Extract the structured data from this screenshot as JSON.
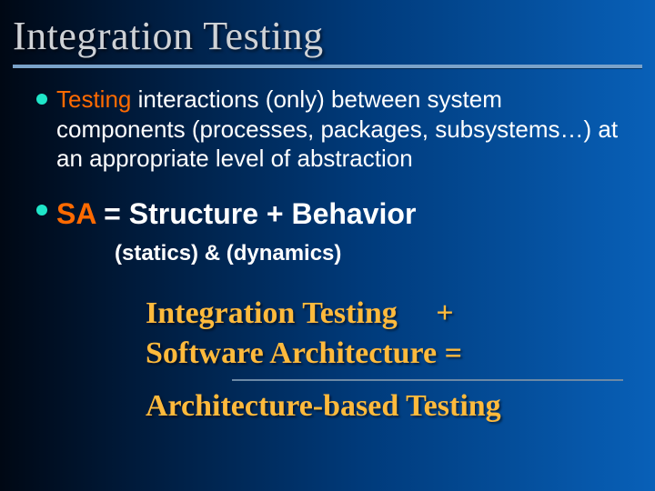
{
  "title": "Integration Testing",
  "bullet1": {
    "lead": "Testing",
    "rest": " interactions (only) between system components (processes, packages, subsystems…) at an appropriate level of abstraction"
  },
  "bullet2": {
    "sa": "SA",
    "rest": " = Structure + Behavior"
  },
  "subline": "(statics)    &  (dynamics)",
  "equation": {
    "line1": "Integration Testing     +",
    "line2": "Software Architecture =",
    "line3": "Architecture-based Testing"
  }
}
